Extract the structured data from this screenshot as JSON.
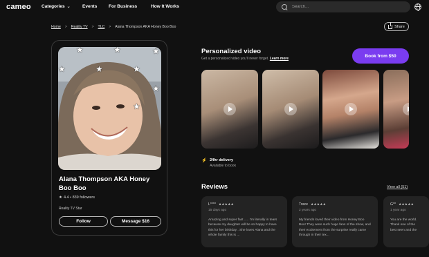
{
  "nav": {
    "logo": "cameo",
    "categories_label": "Categories",
    "events_label": "Events",
    "business_label": "For Business",
    "how_label": "How It Works",
    "search_placeholder": "Search..."
  },
  "breadcrumb": {
    "items": [
      "Home",
      "Reality TV",
      "TLC",
      "Alana Thompson AKA Honey Boo Boo"
    ]
  },
  "share_label": "Share",
  "profile": {
    "name": "Alana Thompson AKA Honey Boo Boo",
    "rating": "4.4",
    "followers": "839 followers",
    "stats_text": "4.4 • 839 followers",
    "category": "Reality TV Star",
    "follow_label": "Follow",
    "message_label": "Message $16"
  },
  "personalized": {
    "title": "Personalized video",
    "subtitle": "Get a personalized video you'll never forget.",
    "learn_more": "Learn more",
    "book_label": "Book from $50",
    "delivery_title": "24hr delivery",
    "delivery_sub": "Available to book"
  },
  "reviews": {
    "title": "Reviews",
    "view_all": "View all (51)",
    "items": [
      {
        "author": "L****",
        "stars": "★★★★★",
        "date": "15 days ago",
        "text": "Amazing and super fast ..... I'm literally in tears because my daughter will be so happy to have this for her birthday . She loves Alana and the whole family this is ..."
      },
      {
        "author": "Trace",
        "stars": "★★★★★",
        "date": "2 years ago",
        "text": "My friends loved their video from Honey Boo Boo! They were such huge fans of the show, and their excitement from the surprise really came through in their tex..."
      },
      {
        "author": "G**",
        "stars": "★★★★★",
        "date": "1 year ago",
        "text": "You are the world. Thank one of the best seen and the"
      }
    ]
  }
}
